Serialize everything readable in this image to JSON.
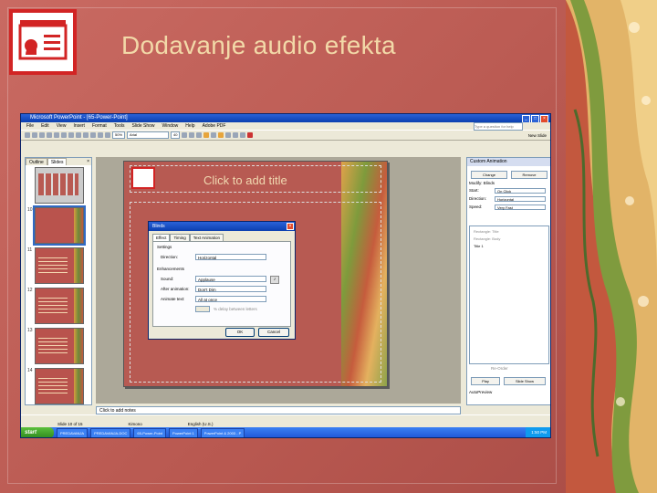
{
  "slide_title": "Dodavanje audio efekta",
  "colors": {
    "background": "#c1605a",
    "title": "#f2d9a8",
    "logo_border": "#d22424"
  },
  "app": {
    "title": "Microsoft PowerPoint - [65-Power-Point]",
    "menus": [
      "File",
      "Edit",
      "View",
      "Insert",
      "Format",
      "Tools",
      "Slide Show",
      "Window",
      "Help",
      "Adobe PDF"
    ],
    "help_placeholder": "Type a question for help",
    "font_name": "Arial",
    "font_size": "40",
    "zoom": "50%",
    "new_slide_label": "New Slide"
  },
  "left_pane": {
    "tabs": [
      "Outline",
      "Slides"
    ],
    "thumbnails": [
      {
        "number": "",
        "selected": false
      },
      {
        "number": "10",
        "selected": true
      },
      {
        "number": "11",
        "selected": false
      },
      {
        "number": "12",
        "selected": false
      },
      {
        "number": "13",
        "selected": false
      },
      {
        "number": "14",
        "selected": false
      }
    ]
  },
  "slide": {
    "title_placeholder": "Click to add title"
  },
  "dialog": {
    "title": "Blinds",
    "tabs": [
      "Effect",
      "Timing",
      "Text Animation"
    ],
    "settings_label": "Settings",
    "direction_label": "Direction:",
    "direction_value": "Horizontal",
    "enhancements_label": "Enhancements",
    "sound_label": "Sound:",
    "sound_value": "Applause",
    "after_animation_label": "After animation:",
    "after_animation_value": "Don't Dim",
    "animate_text_label": "Animate text:",
    "animate_text_value": "All at once",
    "delay_label": "% delay between letters",
    "ok_label": "OK",
    "cancel_label": "Cancel"
  },
  "task_pane": {
    "header": "Custom Animation",
    "change_label": "Change",
    "remove_label": "Remove",
    "modify_label": "Modify: Blinds",
    "start_label": "Start:",
    "start_value": "On Click",
    "direction_label": "Direction:",
    "direction_value": "Horizontal",
    "speed_label": "Speed:",
    "speed_value": "Very Fast",
    "list_items": [
      "Rectangle: Title",
      "Rectangle: Body",
      "Title 1"
    ],
    "reorder_label": "Re-Order",
    "play_label": "Play",
    "slideshow_label": "Slide Show",
    "autopreview_label": "AutoPreview"
  },
  "notes_placeholder": "Click to add notes",
  "status": {
    "slide": "Slide 10 of 15",
    "design": "Kimono",
    "language": "English (U.S.)"
  },
  "taskbar": {
    "start_label": "start",
    "items": [
      "PREDAVANJA",
      "PREDAVANJA-DOC",
      "65-Power-Point",
      "PowerPoint 1",
      "PowerPoint & 2003 - P"
    ],
    "clock": "1:50 PM"
  }
}
